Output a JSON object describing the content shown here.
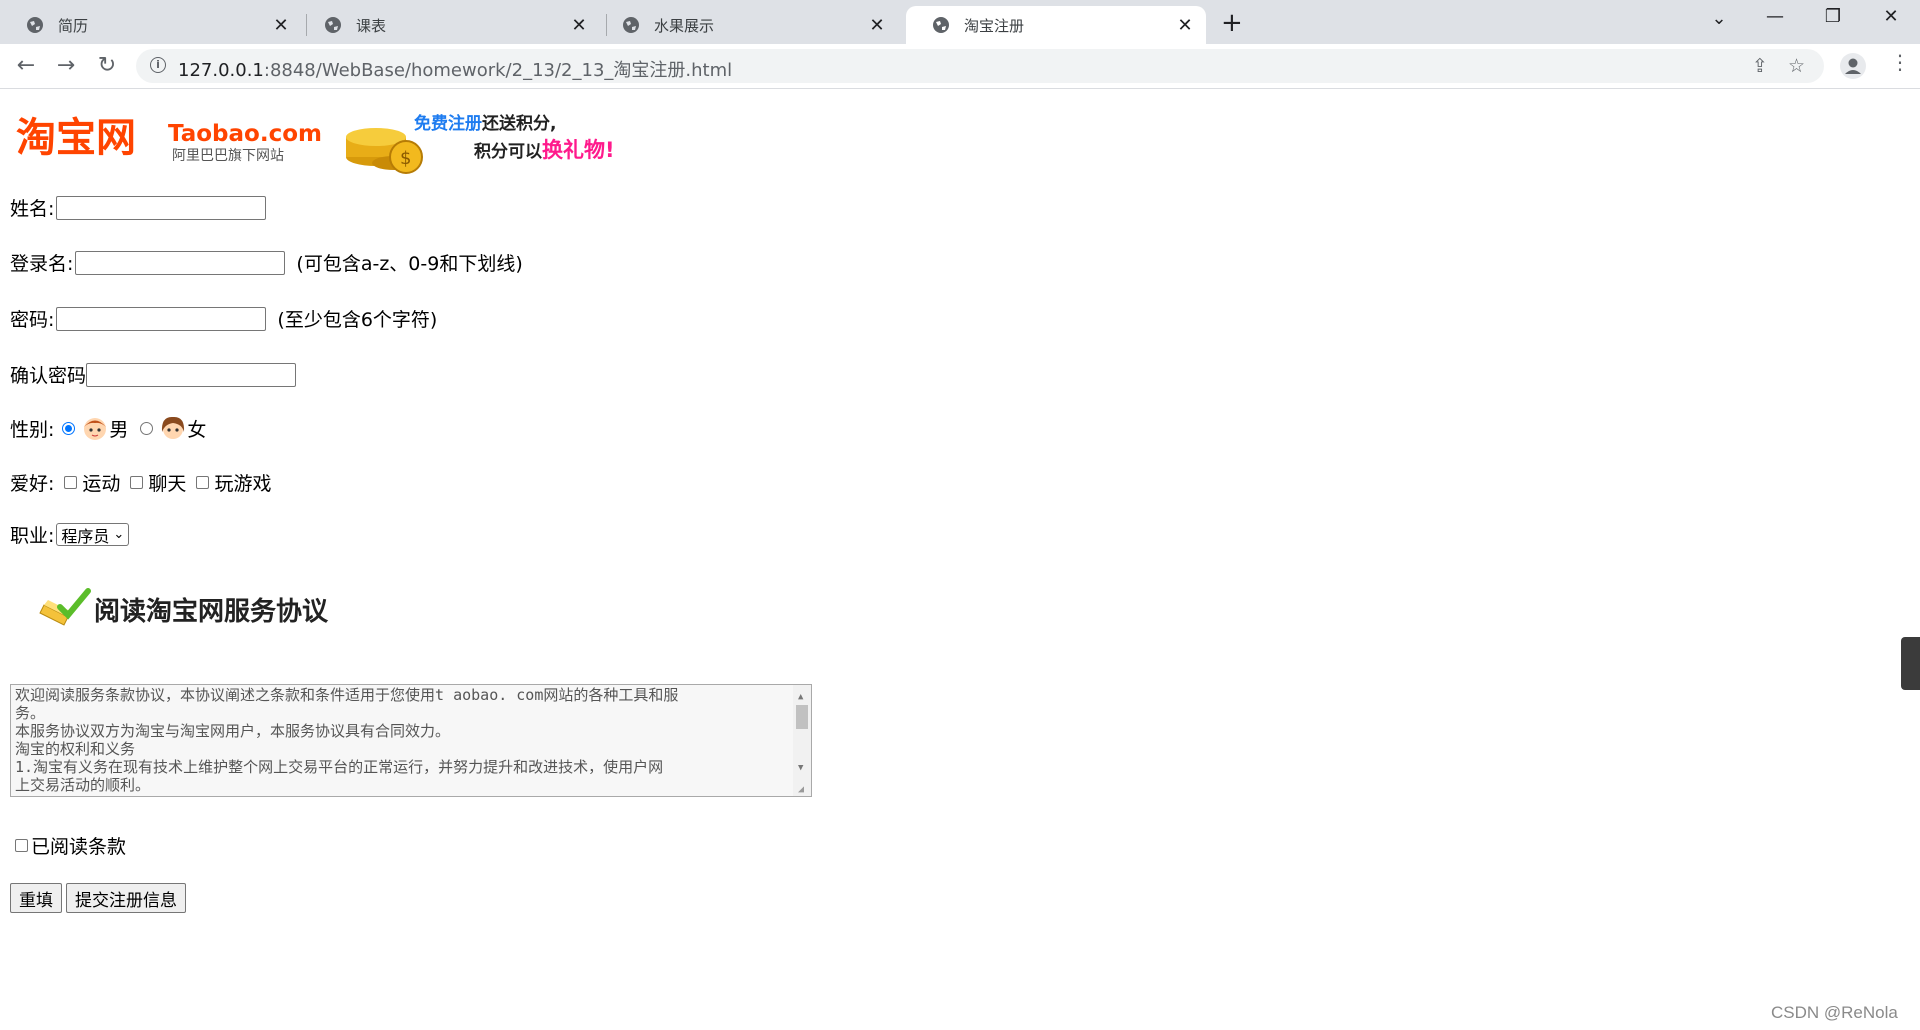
{
  "browser": {
    "tabs": [
      {
        "label": "简历",
        "active": false
      },
      {
        "label": "课表",
        "active": false
      },
      {
        "label": "水果展示",
        "active": false
      },
      {
        "label": "淘宝注册",
        "active": true
      }
    ],
    "url_host": "127.0.0.1",
    "url_path": ":8848/WebBase/homework/2_13/2_13_淘宝注册.html"
  },
  "banner": {
    "logo_cn": "淘宝网",
    "logo_en": "Taobao.com",
    "logo_sub": "阿里巴巴旗下网站",
    "promo_line1_highlight": "免费注册",
    "promo_line1_rest": "还送积分,",
    "promo_line2_start": "积分可以",
    "promo_line2_highlight": "换礼物!"
  },
  "form": {
    "name_label": "姓名:",
    "login_label": "登录名:",
    "login_hint": "(可包含a-z、0-9和下划线)",
    "password_label": "密码:",
    "password_hint": "(至少包含6个字符)",
    "confirm_label": "确认密码",
    "gender_label": "性别:",
    "gender_male": "男",
    "gender_female": "女",
    "hobby_label": "爱好:",
    "hobbies": [
      "运动",
      "聊天",
      "玩游戏"
    ],
    "job_label": "职业:",
    "job_selected": "程序员",
    "agreement_title": "阅读淘宝网服务协议",
    "agreement_lines": [
      "欢迎阅读服务条款协议，本协议阐述之条款和条件适用于您使用t aobao. com网站的各种工具和服",
      "务。",
      "本服务协议双方为淘宝与淘宝网用户，本服务协议具有合同效力。",
      "淘宝的权利和义务",
      "1.淘宝有义务在现有技术上维护整个网上交易平台的正常运行，并努力提升和改进技术，使用户网",
      "上交易活动的顺利。"
    ],
    "read_terms_label": "已阅读条款",
    "reset_button": "重填",
    "submit_button": "提交注册信息"
  },
  "watermark": "CSDN @ReNola"
}
